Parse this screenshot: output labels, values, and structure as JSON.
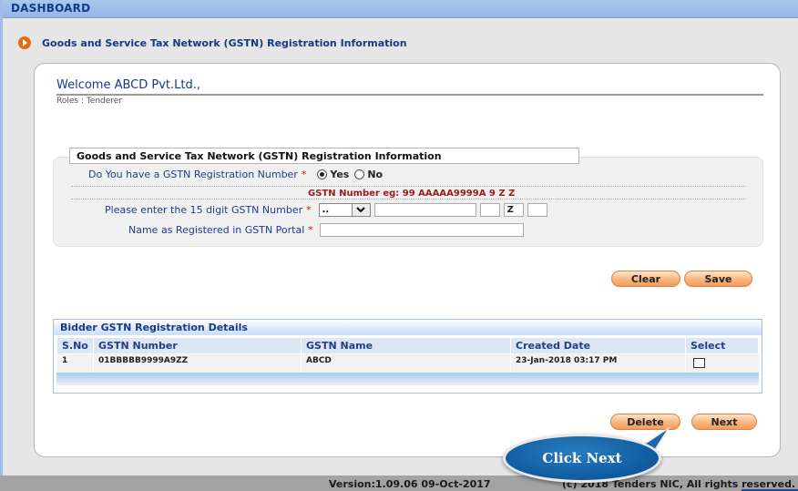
{
  "header": {
    "title": "DASHBOARD"
  },
  "page_heading": "Goods and Service Tax Network (GSTN) Registration Information",
  "welcome": {
    "title": "Welcome ABCD Pvt.Ltd.,",
    "roles": "Roles : Tenderer"
  },
  "form": {
    "section_title": "Goods and Service Tax Network (GSTN) Registration Information",
    "gstn_question": "Do You have a GSTN Registration Number",
    "required_mark": "*",
    "radio_options": [
      {
        "label": "Yes",
        "checked": true
      },
      {
        "label": "No",
        "checked": false
      }
    ],
    "example_text": "GSTN Number eg: 99 AAAAA9999A 9 Z Z",
    "gstn_number_label": "Please enter the 15 digit GSTN Number",
    "state_select_value": "..",
    "pan_value": "",
    "entity_value": "",
    "z_value": "Z",
    "checksum_value": "",
    "registered_name_label": "Name as Registered in GSTN Portal",
    "registered_name_value": ""
  },
  "buttons": {
    "clear": "Clear",
    "save": "Save",
    "delete": "Delete",
    "next": "Next"
  },
  "grid": {
    "title": "Bidder GSTN Registration Details",
    "columns": [
      "S.No",
      "GSTN Number",
      "GSTN Name",
      "Created Date",
      "Select"
    ],
    "rows": [
      {
        "sno": "1",
        "gstn_number": "01BBBBB9999A9ZZ",
        "gstn_name": "ABCD",
        "created_date": "23-Jan-2018 03:17 PM",
        "selected": false
      }
    ]
  },
  "footer": {
    "version": "Version:1.09.06 09-Oct-2017",
    "copyright": "(c) 2018 Tenders NIC, All rights reserved."
  },
  "callout": {
    "text": "Click Next"
  },
  "colors": {
    "header_blue": "#15398a",
    "button_orange": "#f8b27a",
    "callout_blue": "#0f5a9e",
    "required_red": "#d01818"
  }
}
